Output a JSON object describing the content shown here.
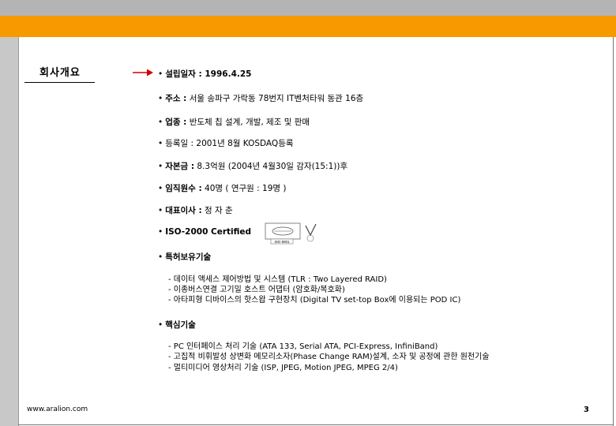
{
  "slide": {
    "title": "회사개요",
    "items": [
      {
        "label": "설립일자 : 1996.4.25",
        "value": ""
      },
      {
        "label": "주소 :",
        "value": " 서울 송파구 가락동 78번지 IT벤처타워 동관 16층"
      },
      {
        "label": "업종 :",
        "value": " 반도체 칩 설계, 개발, 제조 및 판매"
      },
      {
        "label": "",
        "value": "등록일 : 2001년 8월 KOSDAQ등록"
      },
      {
        "label": "자본금 :",
        "value": "  8.3억원 (2004년 4월30일 감자(15:1))후"
      },
      {
        "label": "임직원수 :",
        "value": "  40명 ( 연구원 : 19명 )"
      },
      {
        "label": "대표이사 :",
        "value": "  정 자 춘"
      },
      {
        "label": "ISO-2000 Certified",
        "value": ""
      },
      {
        "label": "특허보유기술",
        "value": ""
      }
    ],
    "patents": [
      "- 데이터 액세스 제어방법 및 시스템 (TLR : Two Layered RAID)",
      "- 이종버스연결 고기밀 호스트 어댑터 (암호화/복호화)",
      "- 아타피형 디바이스의 핫스왑 구현장치 (Digital TV set-top Box에 이용되는 POD IC)"
    ],
    "core_label": "핵심기술",
    "core_techs": [
      "- PC 인터페이스 처리 기술 (ATA 133, Serial ATA, PCI-Express, InfiniBand)",
      "- 고집적 비휘발성 상변화 메모리소자(Phase Change RAM)설계, 소자 및 공정에 관한 원천기술",
      "- 멀티미디어 영상처리 기술 (ISP, JPEG, Motion JPEG, MPEG 2/4)"
    ],
    "iso_logo_text": "ISO 9001",
    "footer_url": "www.aralion.com",
    "page_number": "3",
    "bullet": "•",
    "colors": {
      "orange_band": "#f79a00",
      "gray_band": "#b4b4b4",
      "arrow": "#d40000"
    }
  }
}
